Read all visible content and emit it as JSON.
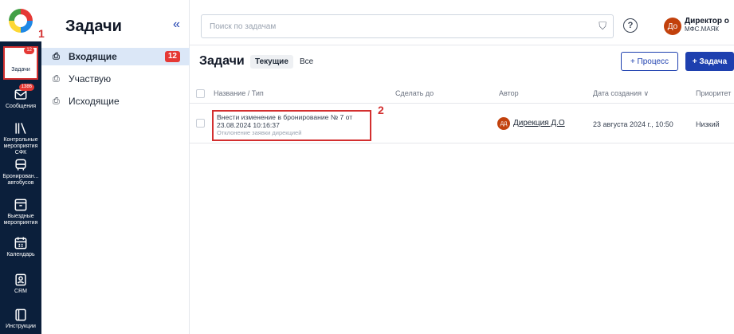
{
  "rail": {
    "annotation": "1",
    "items": [
      {
        "label": "Задачи",
        "icon": "tasks-icon",
        "badge": "12"
      },
      {
        "label": "Сообщения",
        "icon": "messages-icon",
        "badge": "1386"
      },
      {
        "label": "Контрольные мероприятия СФК",
        "icon": "control-events-icon",
        "badge": ""
      },
      {
        "label": "Бронирован... автобусов",
        "icon": "bus-icon",
        "badge": ""
      },
      {
        "label": "Выездные мероприятия",
        "icon": "archive-icon",
        "badge": ""
      },
      {
        "label": "Календарь",
        "icon": "calendar-icon",
        "badge": ""
      },
      {
        "label": "CRM",
        "icon": "crm-icon",
        "badge": ""
      },
      {
        "label": "Инструкции",
        "icon": "instructions-icon",
        "badge": ""
      }
    ]
  },
  "sidebar": {
    "title": "Задачи",
    "collapse_glyph": "«",
    "items": [
      {
        "label": "Входящие",
        "badge": "12"
      },
      {
        "label": "Участвую",
        "badge": ""
      },
      {
        "label": "Исходящие",
        "badge": ""
      }
    ]
  },
  "header": {
    "search_placeholder": "Поиск по задачам",
    "user_initials": "До",
    "user_name": "Директор о",
    "user_org": "МФС.МАЯК"
  },
  "content": {
    "title": "Задачи",
    "tabs": [
      "Текущие",
      "Все"
    ],
    "process_button": "+ Процесс",
    "task_button": "+ Задача",
    "columns": [
      "Название / Тип",
      "Сделать до",
      "Автор",
      "Дата создания ∨",
      "Приоритет"
    ],
    "annotation": "2",
    "rows": [
      {
        "title_line1": "Внести изменение в бронирование № 7 от",
        "title_line2": "23.08.2024 10:16:37",
        "type": "Отклонение заявки дирекцией",
        "due": "",
        "author_initials": "ДД",
        "author": "Дирекция Д.О",
        "created": "23 августа 2024 г., 10:50",
        "priority": "Низкий"
      }
    ]
  },
  "colors": {
    "rail_bg": "#0b1f3b",
    "accent": "#1e40af",
    "badge": "#e53935",
    "highlight": "#d32f2f"
  }
}
